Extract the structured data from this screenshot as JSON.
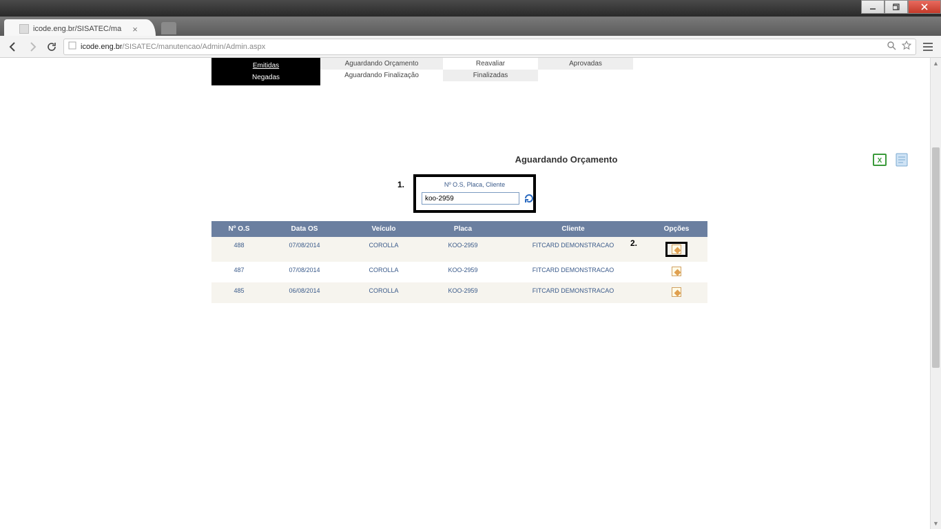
{
  "browser": {
    "tab_title": "icode.eng.br/SISATEC/ma",
    "url_host": "icode.eng.br",
    "url_path": "/SISATEC/manutencao/Admin/Admin.aspx"
  },
  "status_tabs": {
    "col1": {
      "top": "Emitidas",
      "bottom": "Negadas"
    },
    "col2": {
      "top": "Aguardando Orçamento",
      "bottom": "Aguardando Finalização"
    },
    "col3": {
      "top": "Reavaliar",
      "bottom": "Finalizadas"
    },
    "col4": {
      "top": "Aprovadas"
    }
  },
  "section_title": "Aguardando Orçamento",
  "search": {
    "label": "Nº O.S, Placa, Cliente",
    "value": "koo-2959"
  },
  "annotations": {
    "one": "1.",
    "two": "2."
  },
  "table": {
    "headers": {
      "os": "Nº O.S",
      "data": "Data OS",
      "veiculo": "Veículo",
      "placa": "Placa",
      "cliente": "Cliente",
      "opcoes": "Opções"
    },
    "rows": [
      {
        "os": "488",
        "data": "07/08/2014",
        "veiculo": "COROLLA",
        "placa": "KOO-2959",
        "cliente": "FITCARD DEMONSTRACAO"
      },
      {
        "os": "487",
        "data": "07/08/2014",
        "veiculo": "COROLLA",
        "placa": "KOO-2959",
        "cliente": "FITCARD DEMONSTRACAO"
      },
      {
        "os": "485",
        "data": "06/08/2014",
        "veiculo": "COROLLA",
        "placa": "KOO-2959",
        "cliente": "FITCARD DEMONSTRACAO"
      }
    ]
  }
}
